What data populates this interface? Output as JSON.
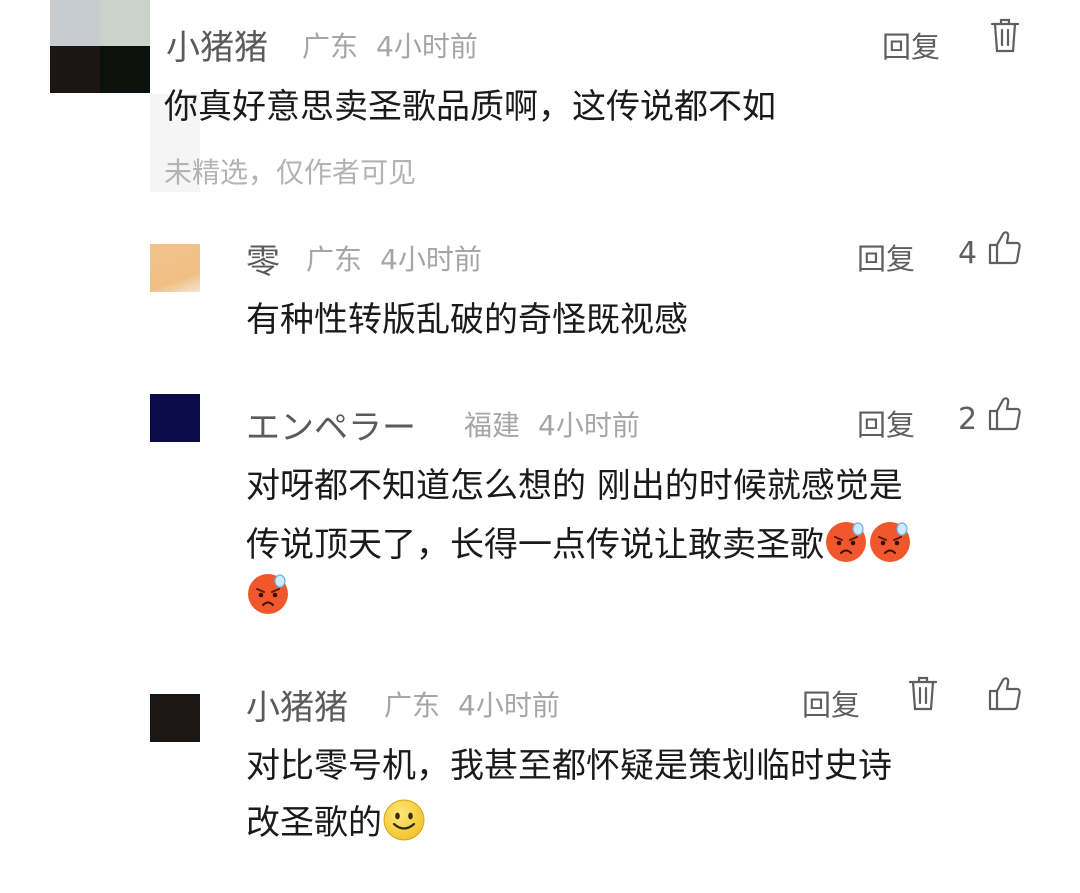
{
  "comments": [
    {
      "username": "小猪猪",
      "location": "广东",
      "time": "4小时前",
      "reply_label": "回复",
      "text_lines": [
        "你真好意思卖圣歌品质啊，这传说都不如"
      ],
      "status_note": "未精选，仅作者可见",
      "has_delete": true
    },
    {
      "username": "零",
      "location": "广东",
      "time": "4小时前",
      "reply_label": "回复",
      "likes": "4",
      "text_lines": [
        "有种性转版乱破的奇怪既视感"
      ]
    },
    {
      "username": "エンペラー",
      "location": "福建",
      "time": "4小时前",
      "reply_label": "回复",
      "likes": "2",
      "text_lines": [
        "对呀都不知道怎么想的 刚出的时候就感觉是",
        "传说顶天了，长得一点传说让敢卖圣歌"
      ],
      "emojis": [
        "angry-sweat-emoji",
        "angry-sweat-emoji",
        "angry-sweat-emoji"
      ]
    },
    {
      "username": "小猪猪",
      "location": "广东",
      "time": "4小时前",
      "reply_label": "回复",
      "text_lines": [
        "对比零号机，我甚至都怀疑是策划临时史诗",
        "改圣歌的"
      ],
      "emojis": [
        "smile-emoji"
      ],
      "has_delete": true
    }
  ],
  "colors": {
    "angry_face": "#f0572c",
    "smile_face": "#f7d23b"
  }
}
